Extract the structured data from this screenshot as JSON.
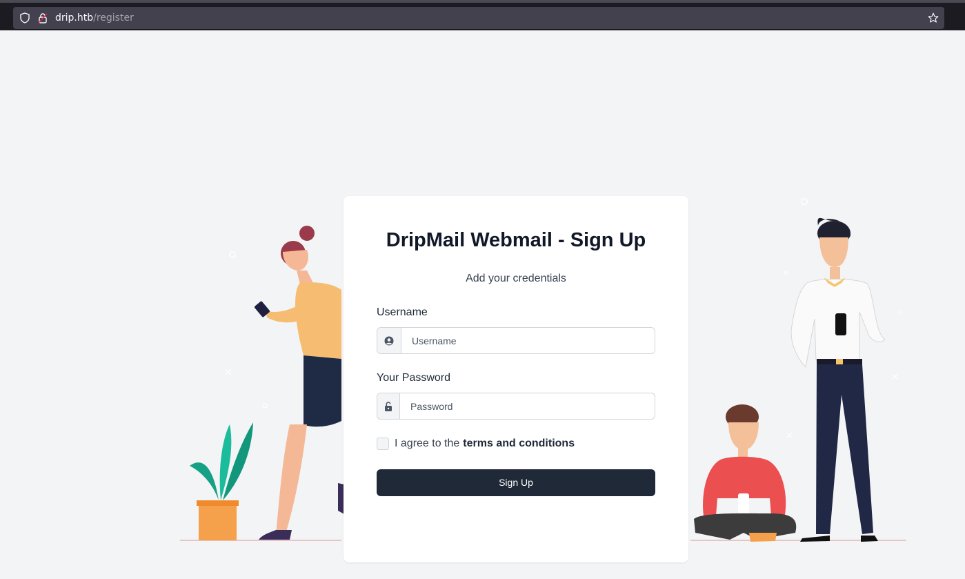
{
  "browser": {
    "url_host": "drip.htb",
    "url_path": "/register"
  },
  "form": {
    "title": "DripMail Webmail - Sign Up",
    "subtitle": "Add your credentials",
    "username_label": "Username",
    "username_placeholder": "Username",
    "password_label": "Your Password",
    "password_placeholder": "Password",
    "agree_text": "I agree to the",
    "terms_link": "terms and conditions",
    "submit_label": "Sign Up"
  },
  "colors": {
    "page_bg": "#f3f4f6",
    "button_bg": "#1f2937",
    "card_bg": "#ffffff"
  }
}
